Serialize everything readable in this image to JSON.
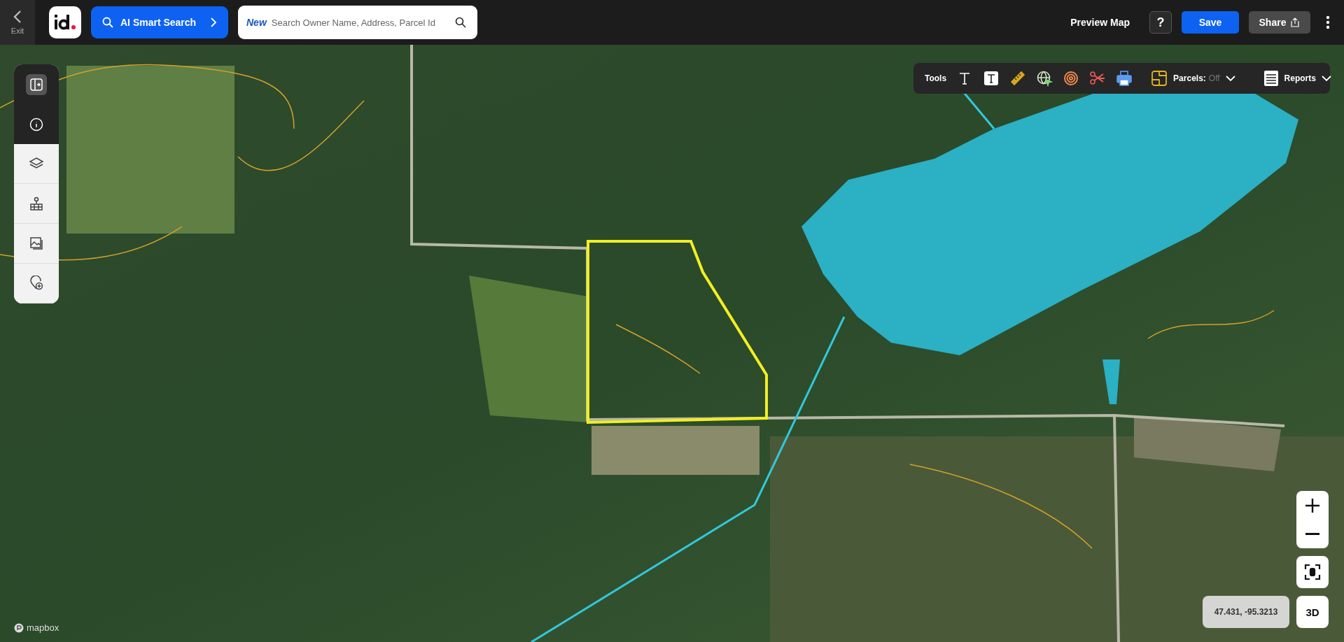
{
  "header": {
    "exit_label": "Exit",
    "ai_search": "AI Smart Search",
    "search": {
      "badge": "New",
      "placeholder": "Search Owner Name, Address, Parcel Id"
    },
    "preview": "Preview Map",
    "help": "?",
    "save": "Save",
    "share": "Share"
  },
  "sidebar": {
    "items": [
      {
        "kind": "panel",
        "selected": true
      },
      {
        "kind": "info",
        "selected": false
      },
      {
        "kind": "layers",
        "selected": false
      },
      {
        "kind": "places",
        "selected": false
      },
      {
        "kind": "images",
        "selected": false
      },
      {
        "kind": "add-place",
        "selected": false
      }
    ]
  },
  "toolbar": {
    "label": "Tools",
    "tools": [
      {
        "kind": "text"
      },
      {
        "kind": "text-box"
      },
      {
        "kind": "ruler"
      },
      {
        "kind": "globe"
      },
      {
        "kind": "rings"
      },
      {
        "kind": "scissors"
      },
      {
        "kind": "print"
      }
    ],
    "parcels": {
      "label": "Parcels:",
      "value": "Off"
    },
    "reports": "Reports"
  },
  "map": {
    "coordinates": "47.431, -95.3213",
    "mode_3d": "3D",
    "attribution": "mapbox"
  }
}
